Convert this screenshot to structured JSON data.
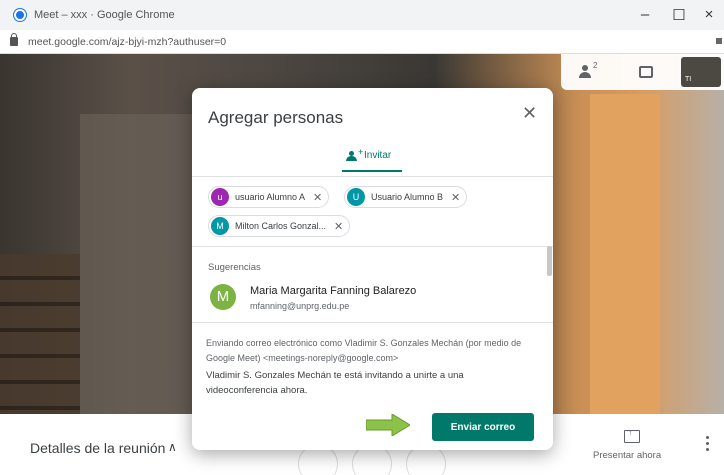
{
  "window": {
    "title": "Meet – xxx · Google Chrome",
    "minimize": "–",
    "maximize": "☐",
    "close": "×"
  },
  "address": {
    "url": "meet.google.com/ajz-bjyi-mzh?authuser=0"
  },
  "top_controls": {
    "people_count": "2",
    "self_initials": "TI"
  },
  "bottom_bar": {
    "details_label": "Detalles de la reunión",
    "present_label": "Presentar ahora"
  },
  "dialog": {
    "title": "Agregar personas",
    "tab_invite": "Invitar",
    "chips": [
      {
        "initial": "u",
        "name": "usuario Alumno A",
        "color": "#9c27b0"
      },
      {
        "initial": "U",
        "name": "Usuario Alumno B",
        "color": "#0097a7"
      },
      {
        "initial": "M",
        "name": "Milton Carlos Gonzal...",
        "color": "#0097a7"
      }
    ],
    "suggestions_label": "Sugerencias",
    "suggestion": {
      "initial": "M",
      "name": "Maria Margarita Fanning Balarezo",
      "email": "mfanning@unprg.edu.pe"
    },
    "notice": "Enviando correo electrónico como Vladimir S. Gonzales Mechán (por medio de Google Meet) <meetings-noreply@google.com>",
    "invite_text": "Vladimir S. Gonzales Mechán te está invitando a unirte a una videoconferencia ahora.",
    "send_button": "Enviar correo"
  },
  "colors": {
    "accent": "#00796b",
    "arrow": "#8bc34a"
  }
}
